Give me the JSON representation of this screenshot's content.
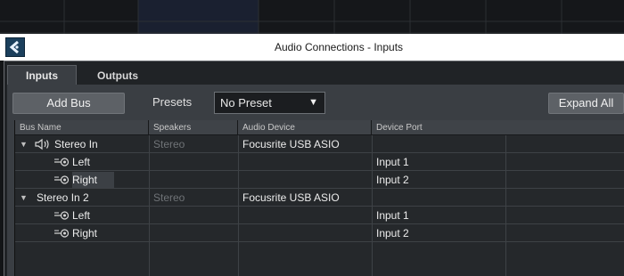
{
  "dialog": {
    "title": "Audio Connections - Inputs"
  },
  "tabs": [
    {
      "label": "Inputs",
      "active": true
    },
    {
      "label": "Outputs",
      "active": false
    }
  ],
  "toolbar": {
    "add_bus_label": "Add Bus",
    "presets_label": "Presets",
    "preset_value": "No Preset",
    "expand_all_label": "Expand All"
  },
  "table": {
    "columns": [
      "Bus Name",
      "Speakers",
      "Audio Device",
      "Device Port"
    ],
    "rows": [
      {
        "bus": "Stereo In",
        "speakers": "Stereo",
        "device": "Focusrite USB ASIO",
        "port": "",
        "kind": "bus",
        "icon": "speaker-icon"
      },
      {
        "bus": "Left",
        "speakers": "",
        "device": "",
        "port": "Input 1",
        "kind": "channel",
        "icon": "channel-connector-icon"
      },
      {
        "bus": "Right",
        "speakers": "",
        "device": "",
        "port": "Input 2",
        "kind": "channel",
        "icon": "channel-connector-icon",
        "selected": true
      },
      {
        "bus": "Stereo In 2",
        "speakers": "Stereo",
        "device": "Focusrite USB ASIO",
        "port": "",
        "kind": "bus",
        "icon": ""
      },
      {
        "bus": "Left",
        "speakers": "",
        "device": "",
        "port": "Input 1",
        "kind": "channel",
        "icon": "channel-connector-icon"
      },
      {
        "bus": "Right",
        "speakers": "",
        "device": "",
        "port": "Input 2",
        "kind": "channel",
        "icon": "channel-connector-icon"
      }
    ]
  },
  "colors": {
    "background": "#2a2d31",
    "table_bg": "#25282b",
    "header_bg": "#3f4348",
    "app_icon": "#1b3f5c"
  }
}
